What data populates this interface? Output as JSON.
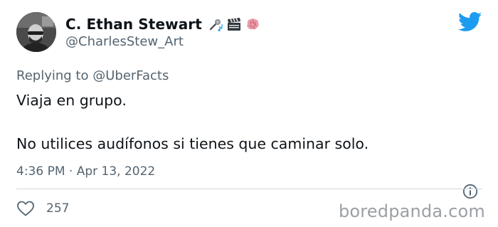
{
  "tweet": {
    "author": {
      "display_name": "C. Ethan Stewart",
      "handle": "@CharlesStew_Art",
      "emojis": [
        "microphone-music-icon",
        "clapper-board-icon",
        "brain-icon"
      ]
    },
    "replying_prefix": "Replying to",
    "replying_to": "@UberFacts",
    "text_line1": "Viaja en grupo.",
    "text_line2": "No utilices audífonos si tienes que caminar solo.",
    "timestamp": "4:36 PM · Apr 13, 2022",
    "likes": "257"
  },
  "watermark": "boredpanda.com",
  "colors": {
    "twitter_blue": "#1d9bf0",
    "secondary_text": "#536471",
    "primary_text": "#0f1419",
    "divider": "#cfd9de"
  }
}
